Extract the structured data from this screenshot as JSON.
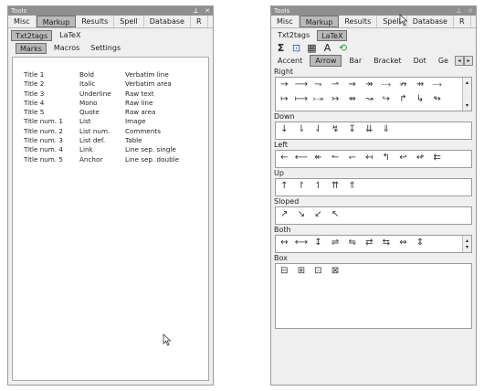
{
  "left": {
    "title": "Tools",
    "pin_icon": "pin-icon",
    "close_icon": "close-icon",
    "tabs": [
      "Misc",
      "Markup",
      "Results",
      "Spell",
      "Database",
      "R"
    ],
    "subtabs": [
      "Txt2tags",
      "LaTeX"
    ],
    "inner_tabs": [
      "Marks",
      "Macros",
      "Settings"
    ],
    "marks": [
      [
        "Title 1",
        "Bold",
        "Verbatim line"
      ],
      [
        "Title 2",
        "Italic",
        "Verbatim area"
      ],
      [
        "Title 3",
        "Underline",
        "Raw text"
      ],
      [
        "Title 4",
        "Mono",
        "Raw line"
      ],
      [
        "Title 5",
        "Quote",
        "Raw area"
      ],
      [
        "Title num. 1",
        "List",
        "Image"
      ],
      [
        "Title num. 2",
        "List num.",
        "Comments"
      ],
      [
        "Title num. 3",
        "List def.",
        "Table"
      ],
      [
        "Title num. 4",
        "Link",
        "Line sep. single"
      ],
      [
        "Title num. 5",
        "Anchor",
        "Line sep. double"
      ]
    ]
  },
  "right": {
    "title": "Tools",
    "tabs": [
      "Misc",
      "Markup",
      "Results",
      "Spell",
      "Database",
      "R"
    ],
    "subtabs": [
      "Txt2tags",
      "LaTeX"
    ],
    "toolbar_icons": [
      "sigma-icon",
      "bracket-icon",
      "table-icon",
      "font-icon",
      "refresh-icon"
    ],
    "toolbar_glyphs": [
      "Σ",
      "⊡",
      "▦",
      "A",
      "⟲"
    ],
    "categories": [
      "Accent",
      "Arrow",
      "Bar",
      "Bracket",
      "Dot",
      "Ge"
    ],
    "groups": [
      {
        "name": "Right",
        "symbols": [
          "→",
          "⟶",
          "⇁",
          "⇀",
          "⇝",
          "↠",
          "⤏",
          "↛",
          "⇸",
          "⤍",
          "↦",
          "⟼",
          "⤐",
          "↣",
          "⇴",
          "↝",
          "↪",
          "↱",
          "↳",
          "↬"
        ]
      },
      {
        "name": "Down",
        "symbols": [
          "↓",
          "⇂",
          "⇃",
          "↯",
          "↧",
          "⇊",
          "⇓"
        ]
      },
      {
        "name": "Left",
        "symbols": [
          "←",
          "⟵",
          "↞",
          "↼",
          "↽",
          "↤",
          "↰",
          "↩",
          "↫",
          "⇇"
        ]
      },
      {
        "name": "Up",
        "symbols": [
          "↑",
          "↾",
          "↿",
          "⇈",
          "⇑"
        ]
      },
      {
        "name": "Sloped",
        "symbols": [
          "↗",
          "↘",
          "↙",
          "↖"
        ]
      },
      {
        "name": "Both",
        "symbols": [
          "↔",
          "⟷",
          "↕",
          "⇌",
          "⇋",
          "⇄",
          "⇆",
          "⇔",
          "⇕"
        ]
      },
      {
        "name": "Box",
        "symbols": [
          "⊟",
          "⊞",
          "⊡",
          "⊠"
        ]
      }
    ]
  }
}
